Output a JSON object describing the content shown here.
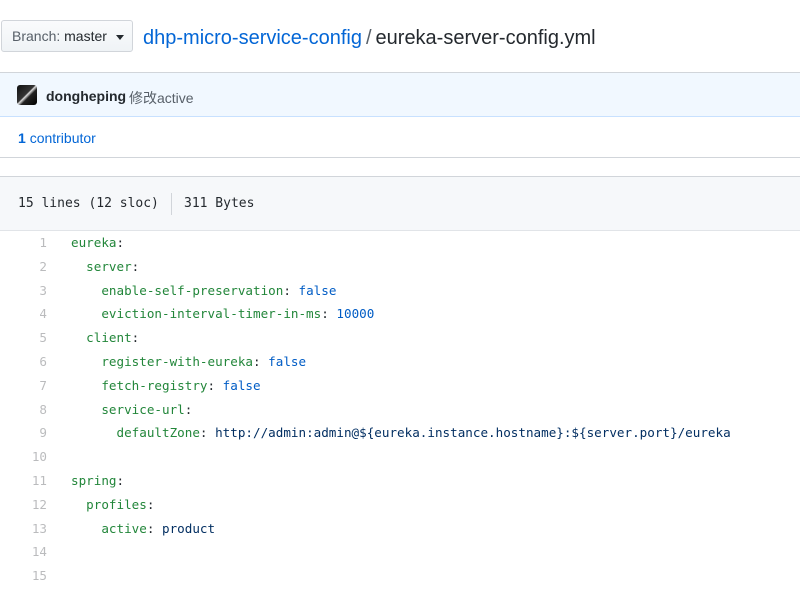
{
  "branch": {
    "label": "Branch:",
    "value": "master"
  },
  "breadcrumb": {
    "repo": "dhp-micro-service-config",
    "separator": "/",
    "file": "eureka-server-config.yml"
  },
  "commit": {
    "author": "dongheping",
    "message": "修改active"
  },
  "contributors": {
    "count": "1",
    "label": "contributor"
  },
  "file_info": {
    "lines": "15 lines (12 sloc)",
    "size": "311 Bytes"
  },
  "code": [
    {
      "num": "1",
      "indent": "",
      "key": "eureka",
      "colon": ":",
      "value": "",
      "vtype": ""
    },
    {
      "num": "2",
      "indent": "  ",
      "key": "server",
      "colon": ":",
      "value": "",
      "vtype": ""
    },
    {
      "num": "3",
      "indent": "    ",
      "key": "enable-self-preservation",
      "colon": ": ",
      "value": "false",
      "vtype": "bool"
    },
    {
      "num": "4",
      "indent": "    ",
      "key": "eviction-interval-timer-in-ms",
      "colon": ": ",
      "value": "10000",
      "vtype": "num"
    },
    {
      "num": "5",
      "indent": "  ",
      "key": "client",
      "colon": ":",
      "value": "",
      "vtype": ""
    },
    {
      "num": "6",
      "indent": "    ",
      "key": "register-with-eureka",
      "colon": ": ",
      "value": "false",
      "vtype": "bool"
    },
    {
      "num": "7",
      "indent": "    ",
      "key": "fetch-registry",
      "colon": ": ",
      "value": "false",
      "vtype": "bool"
    },
    {
      "num": "8",
      "indent": "    ",
      "key": "service-url",
      "colon": ":",
      "value": "",
      "vtype": ""
    },
    {
      "num": "9",
      "indent": "      ",
      "key": "defaultZone",
      "colon": ": ",
      "value": "http://admin:admin@${eureka.instance.hostname}:${server.port}/eureka",
      "vtype": "str"
    },
    {
      "num": "10",
      "indent": "",
      "key": "",
      "colon": "",
      "value": "",
      "vtype": ""
    },
    {
      "num": "11",
      "indent": "",
      "key": "spring",
      "colon": ":",
      "value": "",
      "vtype": ""
    },
    {
      "num": "12",
      "indent": "  ",
      "key": "profiles",
      "colon": ":",
      "value": "",
      "vtype": ""
    },
    {
      "num": "13",
      "indent": "    ",
      "key": "active",
      "colon": ": ",
      "value": "product",
      "vtype": "str"
    },
    {
      "num": "14",
      "indent": "",
      "key": "",
      "colon": "",
      "value": "",
      "vtype": ""
    },
    {
      "num": "15",
      "indent": "",
      "key": "",
      "colon": "",
      "value": "",
      "vtype": ""
    }
  ]
}
